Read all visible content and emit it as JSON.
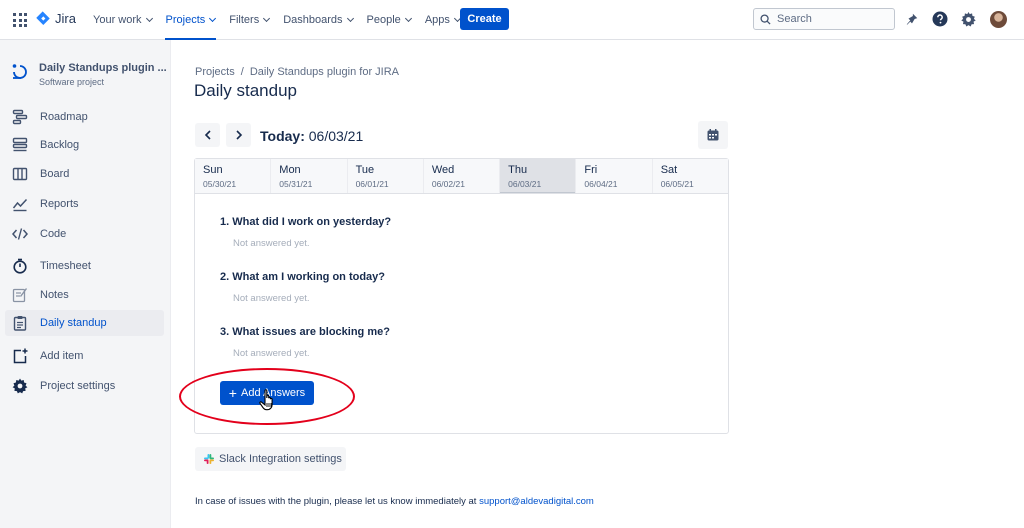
{
  "nav": {
    "logo_text": "Jira",
    "items": [
      {
        "label": "Your work",
        "active": false
      },
      {
        "label": "Projects",
        "active": true
      },
      {
        "label": "Filters",
        "active": false
      },
      {
        "label": "Dashboards",
        "active": false
      },
      {
        "label": "People",
        "active": false
      },
      {
        "label": "Apps",
        "active": false
      }
    ],
    "create_label": "Create",
    "search_placeholder": "Search",
    "icons": [
      "notifications-icon",
      "help-icon",
      "settings-icon"
    ],
    "brand_color": "#0052cc"
  },
  "sidebar": {
    "project_name": "Daily Standups plugin ...",
    "project_type": "Software project",
    "items": [
      {
        "label": "Roadmap",
        "icon": "roadmap-icon",
        "active": false
      },
      {
        "label": "Backlog",
        "icon": "backlog-icon",
        "active": false
      },
      {
        "label": "Board",
        "icon": "board-icon",
        "active": false
      },
      {
        "label": "Reports",
        "icon": "reports-icon",
        "active": false
      },
      {
        "label": "Code",
        "icon": "code-icon",
        "active": false
      },
      {
        "label": "Timesheet",
        "icon": "timer-icon",
        "active": false
      },
      {
        "label": "Notes",
        "icon": "notes-icon",
        "active": false
      },
      {
        "label": "Daily standup",
        "icon": "clipboard-icon",
        "active": true
      },
      {
        "label": "Add item",
        "icon": "add-item-icon",
        "active": false
      },
      {
        "label": "Project settings",
        "icon": "gear-icon",
        "active": false
      }
    ]
  },
  "main": {
    "breadcrumb": [
      "Projects",
      "/",
      "Daily Standups plugin for JIRA"
    ],
    "title": "Daily standup",
    "today_label": "Today:",
    "today_date": "06/03/21",
    "days": [
      {
        "name": "Sun",
        "date": "05/30/21",
        "active": false
      },
      {
        "name": "Mon",
        "date": "05/31/21",
        "active": false
      },
      {
        "name": "Tue",
        "date": "06/01/21",
        "active": false
      },
      {
        "name": "Wed",
        "date": "06/02/21",
        "active": false
      },
      {
        "name": "Thu",
        "date": "06/03/21",
        "active": true
      },
      {
        "name": "Fri",
        "date": "06/04/21",
        "active": false
      },
      {
        "name": "Sat",
        "date": "06/05/21",
        "active": false
      }
    ],
    "questions": [
      {
        "text": "1. What did I work on yesterday?",
        "answer": "Not answered yet."
      },
      {
        "text": "2. What am I working on today?",
        "answer": "Not answered yet."
      },
      {
        "text": "3. What issues are blocking me?",
        "answer": "Not answered yet."
      }
    ],
    "add_answers_label": "Add Answers",
    "slack_label": "Slack Integration settings",
    "footer_text": "In case of issues with the plugin, please let us know immediately at",
    "footer_email": "support@aldevadigital.com",
    "highlight_color": "#e3001b"
  }
}
